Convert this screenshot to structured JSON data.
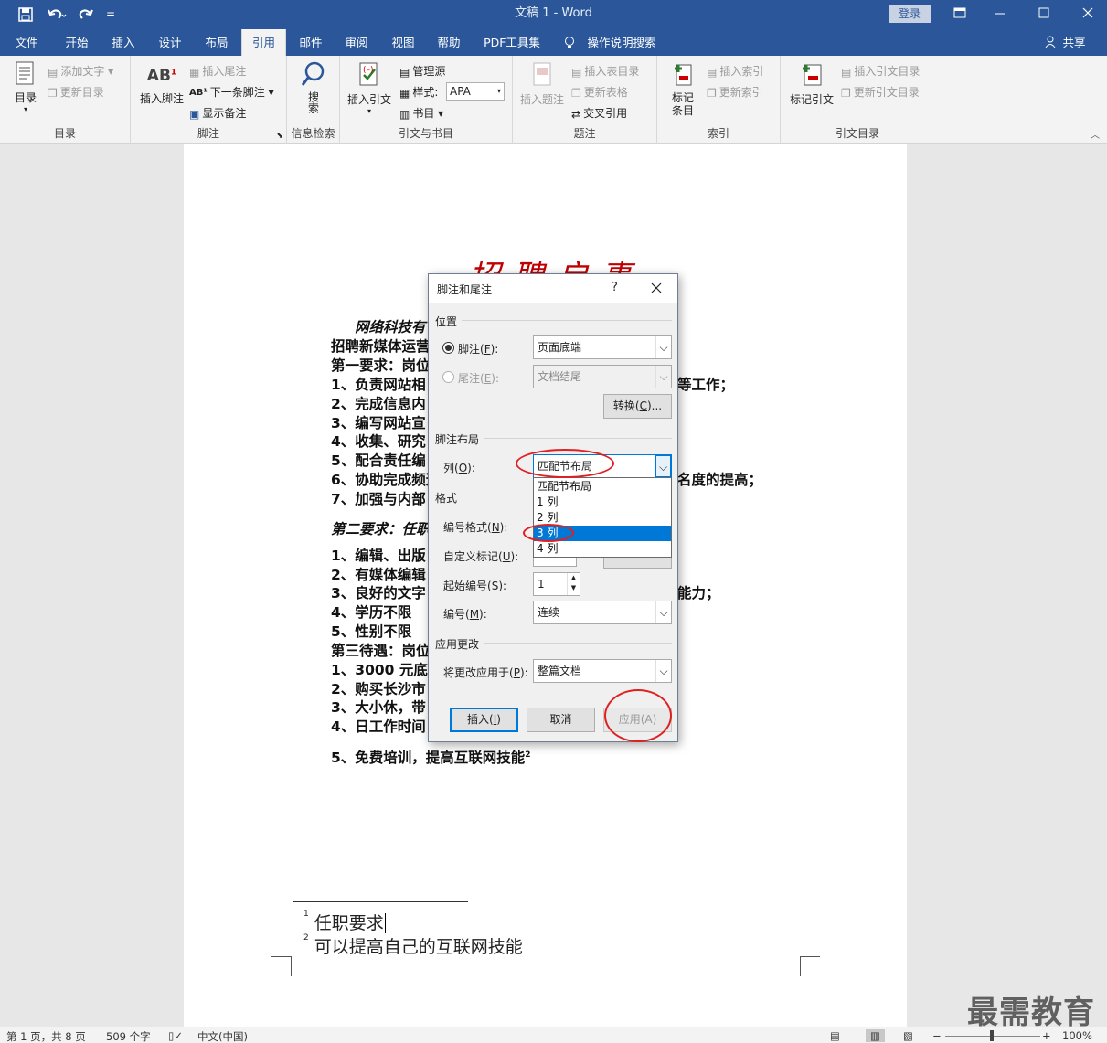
{
  "titlebar": {
    "title": "文稿 1  -  Word",
    "login": "登录",
    "qat_more": "="
  },
  "tabs": [
    "文件",
    "开始",
    "插入",
    "设计",
    "布局",
    "引用",
    "邮件",
    "审阅",
    "视图",
    "帮助",
    "PDF工具集",
    "操作说明搜索"
  ],
  "active_tab": "引用",
  "share": "共享",
  "ribbon": {
    "toc": {
      "big": "目录",
      "add_text": "添加文字",
      "update_toc": "更新目录",
      "group": "目录"
    },
    "footnotes": {
      "insert_footnote": "插入脚注",
      "insert_endnote": "插入尾注",
      "next_footnote": "下一条脚注",
      "show_notes": "显示备注",
      "group": "脚注"
    },
    "research": {
      "search": "搜索",
      "group": "信息检索"
    },
    "citations": {
      "insert_citation": "插入引文",
      "manage_sources": "管理源",
      "style_label": "样式:",
      "style_value": "APA",
      "bibliography": "书目",
      "group": "引文与书目"
    },
    "captions": {
      "insert_caption": "插入题注",
      "insert_tof": "插入表目录",
      "update_table": "更新表格",
      "cross_ref": "交叉引用",
      "group": "题注"
    },
    "index": {
      "mark_entry": "标记条目",
      "insert_index": "插入索引",
      "update_index": "更新索引",
      "group": "索引"
    },
    "toa": {
      "mark_citation": "标记引文",
      "insert_toa": "插入引文目录",
      "update_toa": "更新引文目录",
      "group": "引文目录"
    }
  },
  "document": {
    "title": "招聘启事",
    "lines": [
      "网络科技有",
      "招聘新媒体运营",
      "第一要求：岗位",
      "1、负责网站相",
      "2、完成信息内",
      "3、编写网站宣",
      "4、收集、研究",
      "5、配合责任编",
      "6、协助完成频道",
      "7、加强与内部"
    ],
    "right_fragments": [
      "等工作；",
      "名度的提高；"
    ],
    "section2_heading": "第二要求：任职",
    "lines2": [
      "1、编辑、出版",
      "2、有媒体编辑",
      "3、良好的文字",
      "4、学历不限",
      "5、性别不限"
    ],
    "right_fragment2": "能力；",
    "section3_heading": "第三待遇：岗位",
    "lines3": [
      "1、3000 元底薪",
      "2、购买长沙市",
      "3、大小休，带",
      "4、日工作时间"
    ],
    "last_line": "5、免费培训，提高互联网技能",
    "last_line_sup": "2",
    "footnotes": [
      {
        "num": "1",
        "text": "任职要求"
      },
      {
        "num": "2",
        "text": "可以提高自己的互联网技能"
      }
    ]
  },
  "dialog": {
    "title": "脚注和尾注",
    "help": "?",
    "position_heading": "位置",
    "footnote_label": "脚注(F):",
    "footnote_value": "页面底端",
    "endnote_label": "尾注(E):",
    "endnote_value": "文档结尾",
    "convert_button": "转换(C)...",
    "layout_heading": "脚注布局",
    "columns_label": "列(O):",
    "columns_value": "匹配节布局",
    "columns_options": [
      "匹配节布局",
      "1 列",
      "2 列",
      "3 列",
      "4 列"
    ],
    "highlighted_option": "3 列",
    "format_heading": "格式",
    "number_format_label": "编号格式(N):",
    "custom_mark_label": "自定义标记(U):",
    "symbol_button_partial": "符号(Y)...",
    "start_at_label": "起始编号(S):",
    "start_at_value": "1",
    "numbering_label": "编号(M):",
    "numbering_value": "连续",
    "apply_heading": "应用更改",
    "apply_to_label": "将更改应用于(P):",
    "apply_to_value": "整篇文档",
    "insert_button": "插入(I)",
    "cancel_button": "取消",
    "apply_button": "应用(A)"
  },
  "status": {
    "page": "第 1 页，共 8 页",
    "words": "509 个字",
    "language": "中文(中国)",
    "zoom": "100%"
  },
  "watermark": "最需教育"
}
